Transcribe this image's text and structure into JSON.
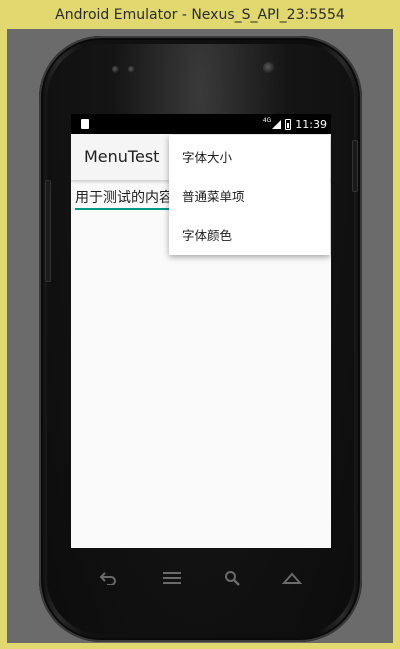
{
  "window": {
    "title": "Android Emulator - Nexus_S_API_23:5554"
  },
  "statusbar": {
    "network": "4G",
    "time": "11:39"
  },
  "app": {
    "title": "MenuTest",
    "content_text": "用于测试的内容"
  },
  "overflow_menu": {
    "items": [
      {
        "label": "字体大小"
      },
      {
        "label": "普通菜单项"
      },
      {
        "label": "字体颜色"
      }
    ]
  },
  "navbar": {
    "icons": [
      "back-icon",
      "menu-icon",
      "search-icon",
      "home-icon"
    ]
  },
  "colors": {
    "window_frame": "#e2d870",
    "emulator_bg": "#6b6b6b",
    "accent": "#009688"
  }
}
